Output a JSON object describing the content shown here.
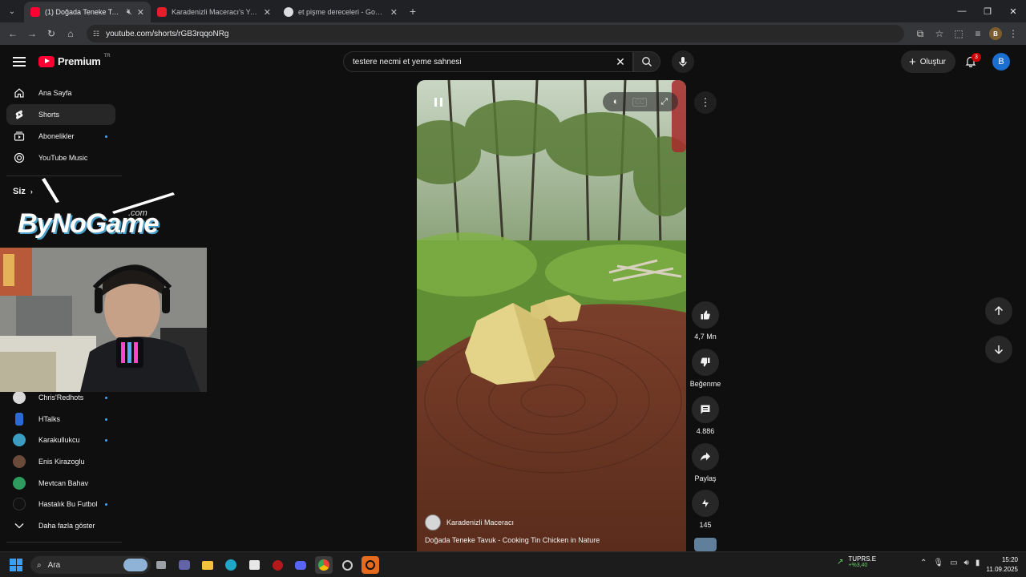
{
  "browser": {
    "tabs": [
      {
        "title": "(1) Doğada Teneke Tavuk - C",
        "favicon_color": "#ff0033",
        "active": true
      },
      {
        "title": "Karadenizli Maceracı's YouTube",
        "favicon_color": "#e41e2b",
        "active": false
      },
      {
        "title": "et pişme dereceleri - Google'da A",
        "favicon_color": "#dadce0",
        "active": false
      }
    ],
    "url": "youtube.com/shorts/rGB3rqqoNRg",
    "profile_initial": "B"
  },
  "masthead": {
    "logo_text": "Premium",
    "country_code": "TR",
    "search_query": "testere necmi et yeme sahnesi",
    "create_label": "Oluştur",
    "notification_count": "3",
    "avatar_initial": "B"
  },
  "sidebar": {
    "items": [
      {
        "label": "Ana Sayfa",
        "icon": "home-icon"
      },
      {
        "label": "Shorts",
        "icon": "shorts-icon",
        "active": true
      },
      {
        "label": "Abonelikler",
        "icon": "subscriptions-icon",
        "dot": true
      },
      {
        "label": "YouTube Music",
        "icon": "music-icon"
      }
    ],
    "you_heading": "Siz",
    "subscriptions": [
      {
        "label": "Chris'Redhots",
        "color": "#d9d9d9"
      },
      {
        "label": "HTalks",
        "color": "#2a6bd6"
      },
      {
        "label": "Karakullukcu",
        "color": "#3b9ec0"
      },
      {
        "label": "Enis Kirazoglu",
        "color": "#6b4a3a"
      },
      {
        "label": "Mevtcan Bahav",
        "color": "#2f9c5f"
      },
      {
        "label": "Hastalık Bu Futbol",
        "color": "#111111"
      }
    ],
    "show_more": "Daha fazla göster"
  },
  "overlay": {
    "brand_text": "ByNoGame",
    "brand_sub": ".com"
  },
  "short": {
    "channel": "Karadenizli Maceracı",
    "title": "Doğada Teneke Tavuk - Cooking Tin Chicken in Nature",
    "likes": "4,7 Mn",
    "dislike_label": "Beğenme",
    "comments": "4.886",
    "share_label": "Paylaş",
    "remix_count": "145"
  },
  "taskbar": {
    "search_placeholder": "Ara",
    "stock_name": "TUPRS.E",
    "stock_change": "+%3,40",
    "time": "15:20",
    "date": "11.09.2025"
  }
}
